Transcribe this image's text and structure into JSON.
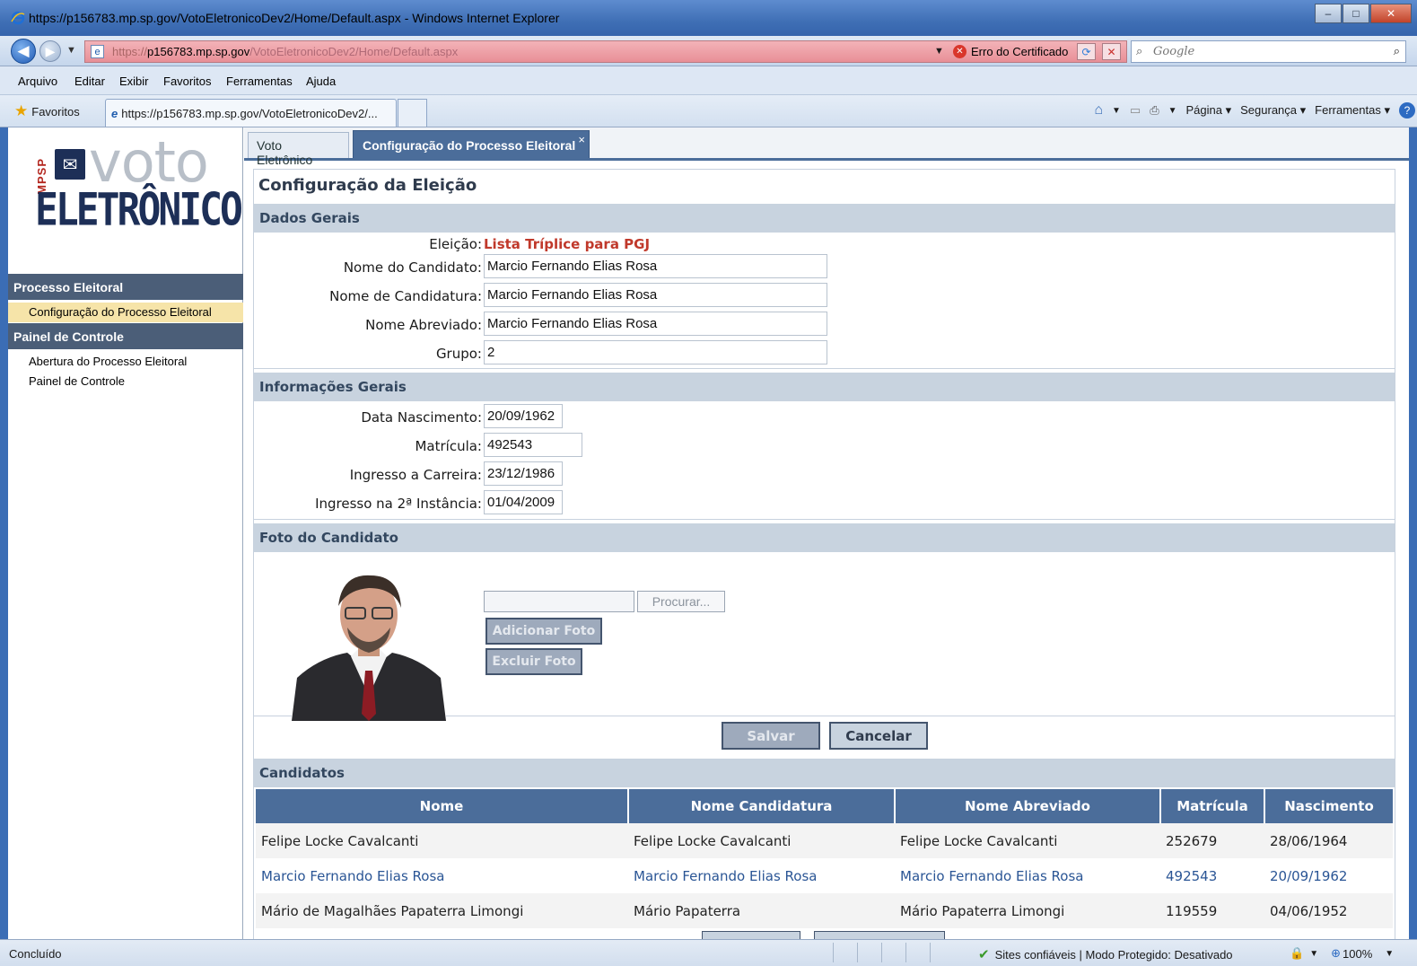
{
  "window": {
    "title": "https://p156783.mp.sp.gov/VotoEletronicoDev2/Home/Default.aspx - Windows Internet Explorer",
    "minimize": "–",
    "maximize": "□",
    "close": "✕"
  },
  "address": {
    "url_prefix": "https://",
    "url_host": "p156783.mp.sp.gov",
    "url_path": "/VotoEletronicoDev2/Home/Default.aspx",
    "cert_error": "Erro do Certificado",
    "search_placeholder": "Google"
  },
  "menu": [
    "Arquivo",
    "Editar",
    "Exibir",
    "Favoritos",
    "Ferramentas",
    "Ajuda"
  ],
  "favbar": {
    "favorites": "Favoritos",
    "tab_title": "https://p156783.mp.sp.gov/VotoEletronicoDev2/...",
    "pagina": "Página ▾",
    "seguranca": "Segurança ▾",
    "ferramentas": "Ferramentas ▾"
  },
  "logo": {
    "mpsp": "MPSP",
    "voto": "voto",
    "eletronico": "ELETRÔNICO"
  },
  "sidebar": {
    "section1": "Processo Eleitoral",
    "item1": "Configuração do Processo Eleitoral",
    "section2": "Painel de Controle",
    "item2": "Abertura do Processo Eleitoral",
    "item3": "Painel de Controle"
  },
  "tabs": {
    "tab1": "Voto Eletrônico",
    "tab2": "Configuração do Processo Eleitoral",
    "close": "×"
  },
  "page_title": "Configuração da Eleição",
  "dados_gerais": {
    "header": "Dados Gerais",
    "eleicao_label": "Eleição:",
    "eleicao_value": "Lista Tríplice para PGJ",
    "nome_candidato_label": "Nome do Candidato:",
    "nome_candidato_value": "Marcio Fernando Elias Rosa",
    "nome_candidatura_label": "Nome de Candidatura:",
    "nome_candidatura_value": "Marcio Fernando Elias Rosa",
    "nome_abreviado_label": "Nome Abreviado:",
    "nome_abreviado_value": "Marcio Fernando Elias Rosa",
    "grupo_label": "Grupo:",
    "grupo_value": "2"
  },
  "info_gerais": {
    "header": "Informações Gerais",
    "nascimento_label": "Data Nascimento:",
    "nascimento_value": "20/09/1962",
    "matricula_label": "Matrícula:",
    "matricula_value": "492543",
    "ingresso_label": "Ingresso a Carreira:",
    "ingresso_value": "23/12/1986",
    "ingresso2_label": "Ingresso na 2ª Instância:",
    "ingresso2_value": "01/04/2009"
  },
  "foto": {
    "header": "Foto do Candidato",
    "browse": "Procurar...",
    "add": "Adicionar Foto",
    "remove": "Excluir Foto"
  },
  "actions": {
    "save": "Salvar",
    "cancel": "Cancelar"
  },
  "candidatos": {
    "header": "Candidatos",
    "columns": [
      "Nome",
      "Nome Candidatura",
      "Nome Abreviado",
      "Matrícula",
      "Nascimento"
    ],
    "rows": [
      [
        "Felipe Locke Cavalcanti",
        "Felipe Locke Cavalcanti",
        "Felipe Locke Cavalcanti",
        "252679",
        "28/06/1964"
      ],
      [
        "Marcio Fernando Elias Rosa",
        "Marcio Fernando Elias Rosa",
        "Marcio Fernando Elias Rosa",
        "492543",
        "20/09/1962"
      ],
      [
        "Mário de Magalhães Papaterra Limongi",
        "Mário Papaterra",
        "Mário Papaterra Limongi",
        "119559",
        "04/06/1952"
      ]
    ]
  },
  "status": {
    "left": "Concluído",
    "zone": "Sites confiáveis | Modo Protegido: Desativado",
    "zoom": "100%"
  }
}
